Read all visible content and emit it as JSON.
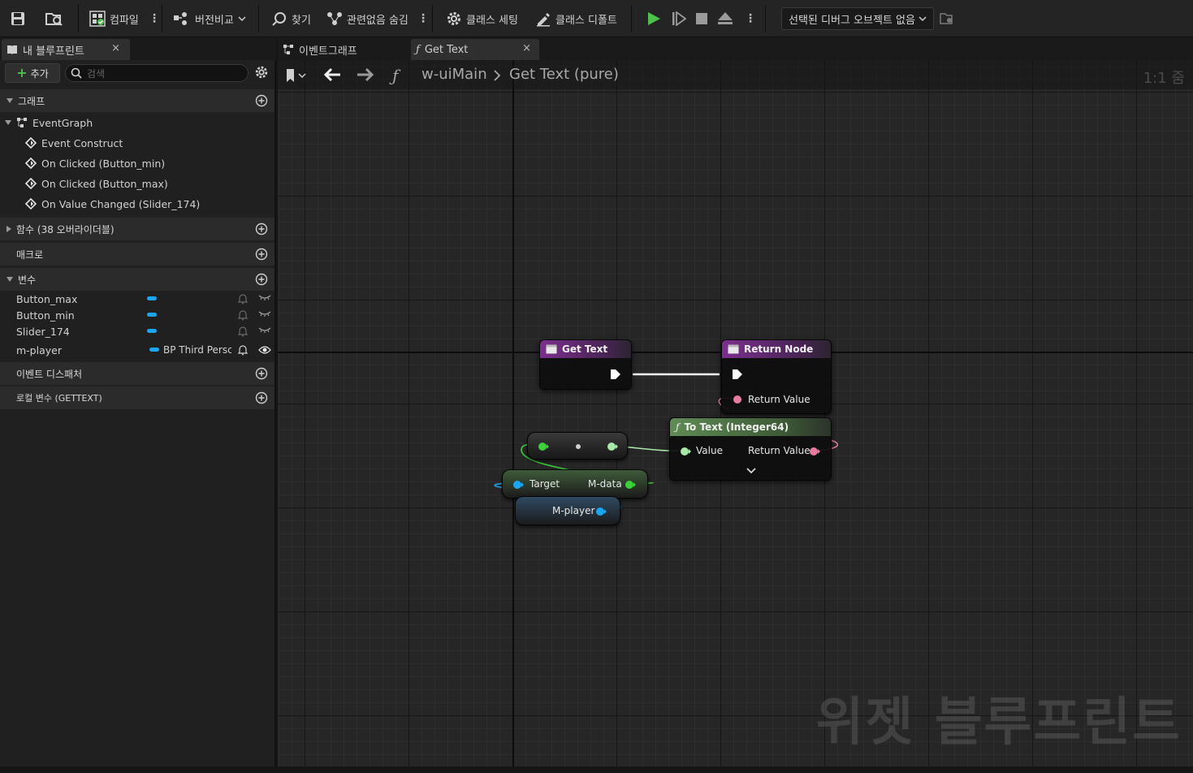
{
  "toolbar": {
    "compile": "컴파일",
    "diff": "버전비교",
    "find": "찾기",
    "hide_unrelated": "관련없음 숨김",
    "class_settings": "클래스 세팅",
    "class_defaults": "클래스 디폴트",
    "debug_object": "선택된 디버그 오브젝트 없음"
  },
  "left_tab": {
    "title": "내 블루프린트",
    "close": "×"
  },
  "left_panel": {
    "add_label": "추가",
    "search_placeholder": "검색",
    "graph_section": "그래프",
    "event_graph": "EventGraph",
    "events": [
      "Event Construct",
      "On Clicked (Button_min)",
      "On Clicked (Button_max)",
      "On Value Changed (Slider_174)"
    ],
    "functions_section": "함수 (38 오버라이더블)",
    "macros_section": "매크로",
    "variables_section": "변수",
    "variables": [
      {
        "name": "Button_max",
        "type": ""
      },
      {
        "name": "Button_min",
        "type": ""
      },
      {
        "name": "Slider_174",
        "type": ""
      },
      {
        "name": "m-player",
        "type": "BP Third Persc"
      }
    ],
    "dispatchers_section": "이벤트 디스패처",
    "local_vars_section": "로컬 변수 (GETTEXT)"
  },
  "graph_tabs": [
    {
      "label": "이벤트그래프"
    },
    {
      "label": "Get Text",
      "close": "×"
    }
  ],
  "breadcrumb": {
    "root": "w-uiMain",
    "current": "Get Text (pure)"
  },
  "zoom_label": "1:1 줌",
  "watermark": "위젯 블루프린트",
  "nodes": {
    "get_text": {
      "title": "Get Text"
    },
    "return_node": {
      "title": "Return Node",
      "pin": "Return Value"
    },
    "to_text": {
      "title": "To Text (Integer64)",
      "in_pin": "Value",
      "out_pin": "Return Value"
    },
    "get_mdata": {
      "in_pin": "Target",
      "out_pin": "M-data"
    },
    "get_mplayer": {
      "pin": "M-player"
    }
  },
  "colors": {
    "exec": "#ffffff",
    "int64": "#a8e8a8",
    "text_pin": "#e87aa0",
    "object_pin": "#1aa6f0",
    "struct_pin": "#3ad13a",
    "function_header": "#7c2f8e",
    "pure_header": "#5f8c54"
  }
}
